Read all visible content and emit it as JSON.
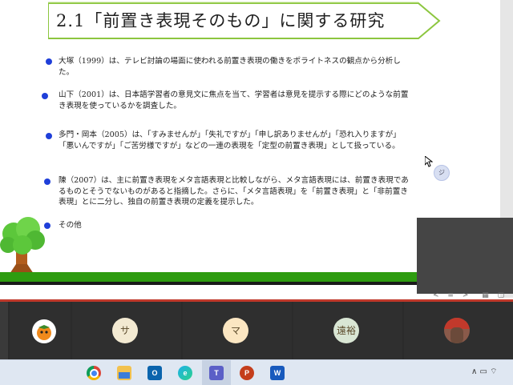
{
  "slide": {
    "title": "2.1「前置き表現そのもの」に関する研究",
    "items": [
      {
        "text": "大塚（1999）は、テレビ討論の場面に使われる前置き表現の働きをポライトネスの観点から分析した。"
      },
      {
        "text": "山下（2001）は、日本語学習者の意見文に焦点を当て、学習者は意見を提示する際にどのような前置き表現を使っているかを調査した。"
      },
      {
        "text": "多門・岡本（2005）は、「すみませんが」「失礼ですが」「申し訳ありませんが」「恐れ入りますが」「悪いんですが」「ご苦労様ですが」などの一連の表現を「定型の前置き表現」として扱っている。"
      },
      {
        "text": "陳（2007）は、主に前置き表現をメタ言語表現と比較しながら、メタ言語表現には、前置き表現であるものとそうでないものがあると指摘した。さらに、「メタ言語表現」を「前置き表現」と「非前置き表現」とに二分し、独自の前置き表現の定義を提示した。"
      },
      {
        "text": "その他"
      }
    ],
    "accent_bullet_color": "#1f3fd9",
    "grass_color": "#2e9c10"
  },
  "sticky_badge": "ジ",
  "participants": [
    {
      "name": "サ",
      "color": "#f3ead2"
    },
    {
      "name": "マ",
      "color": "#fbe6c2"
    },
    {
      "name": "遠裕",
      "color": "#d9e6d4"
    }
  ],
  "taskbar": {
    "icons": [
      "chrome-icon",
      "file-explorer-icon",
      "outlook-icon",
      "edge-icon",
      "teams-icon",
      "powerpoint-icon",
      "word-icon"
    ],
    "tray_text": "∧ ▭ ⌔"
  }
}
